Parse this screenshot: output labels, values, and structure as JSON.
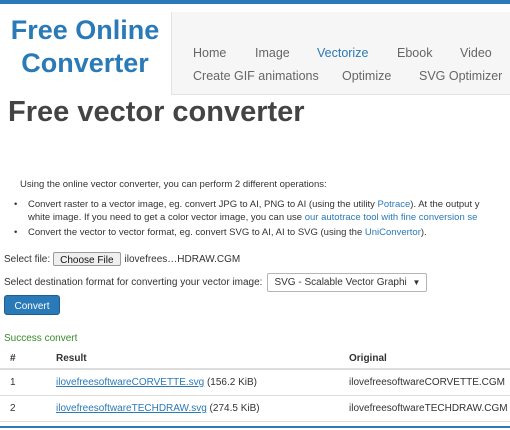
{
  "logo": {
    "line1": "Free Online",
    "line2": "Converter"
  },
  "nav": {
    "row1": [
      "Home",
      "Image",
      "Vectorize",
      "Ebook",
      "Video"
    ],
    "row2": [
      "Create GIF animations",
      "Optimize",
      "SVG Optimizer"
    ],
    "active": "Vectorize"
  },
  "page_title": "Free vector converter",
  "intro": "Using the online vector converter, you can perform 2 different operations:",
  "bullets": {
    "b1_l1_a": "Convert raster to a vector image, eg. convert JPG to AI, PNG to AI (using the utility ",
    "b1_l1_link": "Potrace",
    "b1_l1_b": "). At the output y",
    "b1_l2_a": "white image. If you need to get a color vector image, you can use ",
    "b1_l2_link": "our autotrace tool with fine conversion se",
    "b2_a": "Convert the vector to vector format, eg. convert SVG to AI, AI to SVG (using the ",
    "b2_link": "UniConvertor",
    "b2_b": ")."
  },
  "file": {
    "label": "Select file:",
    "button": "Choose File",
    "filename": "ilovefrees…HDRAW.CGM"
  },
  "format": {
    "label": "Select destination format for converting your vector image:",
    "selected": "SVG - Scalable Vector Graphi"
  },
  "convert_button": "Convert",
  "status": "Success convert",
  "table": {
    "headers": [
      "#",
      "Result",
      "Original"
    ],
    "rows": [
      {
        "num": "1",
        "link": "ilovefreesoftwareCORVETTE.svg",
        "size": " (156.2 KiB)",
        "original": "ilovefreesoftwareCORVETTE.CGM"
      },
      {
        "num": "2",
        "link": "ilovefreesoftwareTECHDRAW.svg",
        "size": " (274.5 KiB)",
        "original": "ilovefreesoftwareTECHDRAW.CGM"
      }
    ]
  }
}
